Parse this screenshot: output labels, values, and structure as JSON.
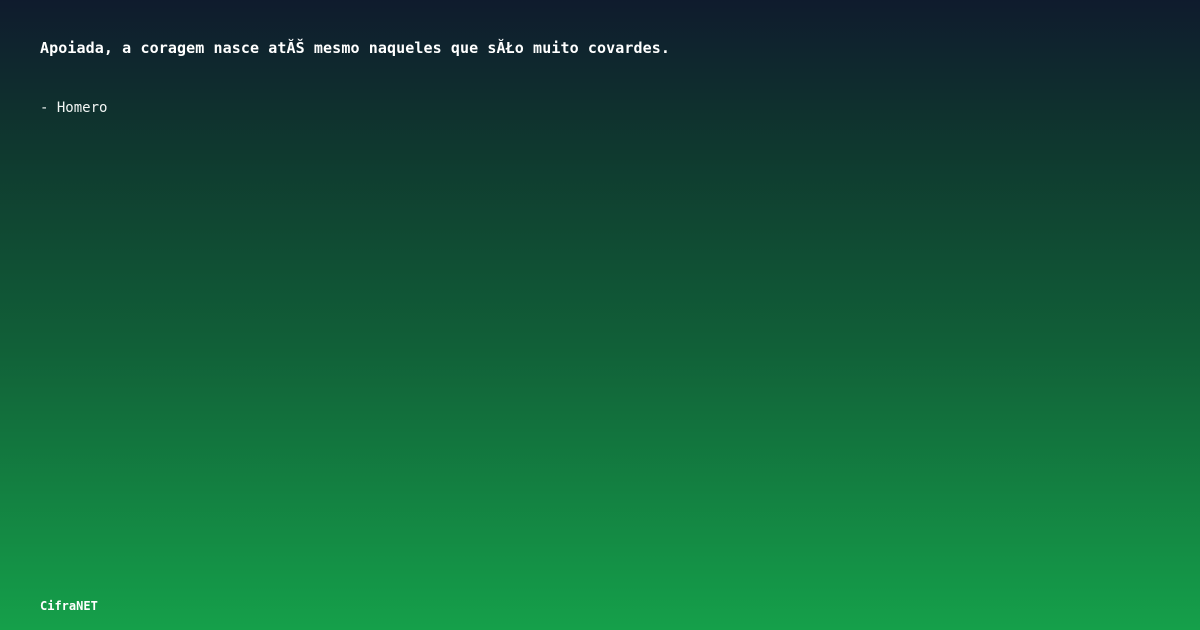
{
  "quote": {
    "text": "Apoiada, a coragem nasce atĂŠ mesmo naqueles que sĂŁo muito covardes.",
    "author": "- Homero"
  },
  "brand": {
    "name": "CifraNET"
  }
}
